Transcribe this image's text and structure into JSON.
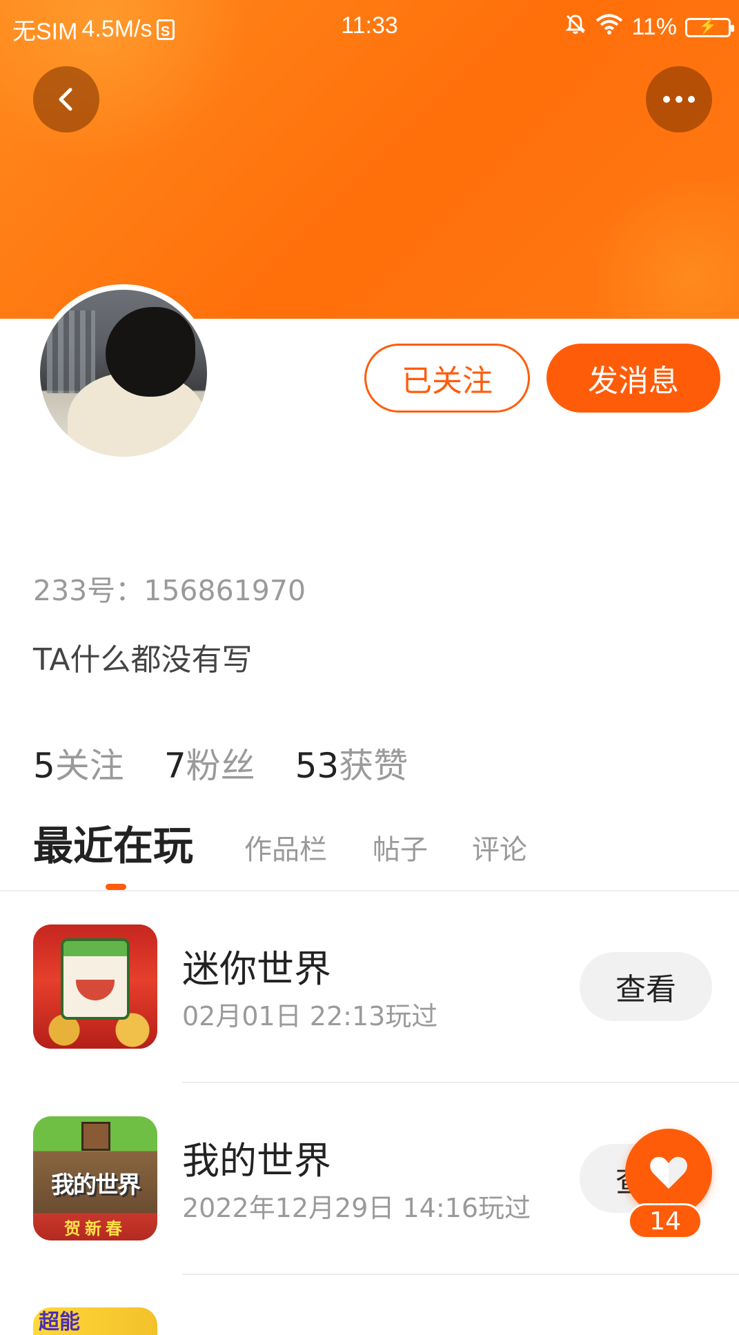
{
  "status_bar": {
    "carrier": "无SIM",
    "speed": "4.5M/s",
    "sim_badge": "S",
    "time": "11:33",
    "battery": "11%"
  },
  "profile": {
    "follow_state_label": "已关注",
    "message_label": "发消息",
    "uid_text": "233号：156861970",
    "bio": "TA什么都没有写",
    "stats": [
      {
        "num": "5",
        "label": "关注"
      },
      {
        "num": "7",
        "label": "粉丝"
      },
      {
        "num": "53",
        "label": "获赞"
      }
    ]
  },
  "tabs": [
    {
      "label": "最近在玩",
      "active": true
    },
    {
      "label": "作品栏",
      "active": false
    },
    {
      "label": "帖子",
      "active": false
    },
    {
      "label": "评论",
      "active": false
    }
  ],
  "games": [
    {
      "name": "迷你世界",
      "played": "02月01日 22:13玩过",
      "action": "查看",
      "icon": "mini-world-icon"
    },
    {
      "name": "我的世界",
      "played": "2022年12月29日 14:16玩过",
      "action": "查看",
      "icon": "minecraft-icon",
      "icon_text": "我的世界",
      "icon_subtext": "贺新春"
    }
  ],
  "partial_icon_text": "超能",
  "like_fab": {
    "count": "14"
  },
  "colors": {
    "accent": "#ff5c0a",
    "banner": "#ff7a14"
  }
}
